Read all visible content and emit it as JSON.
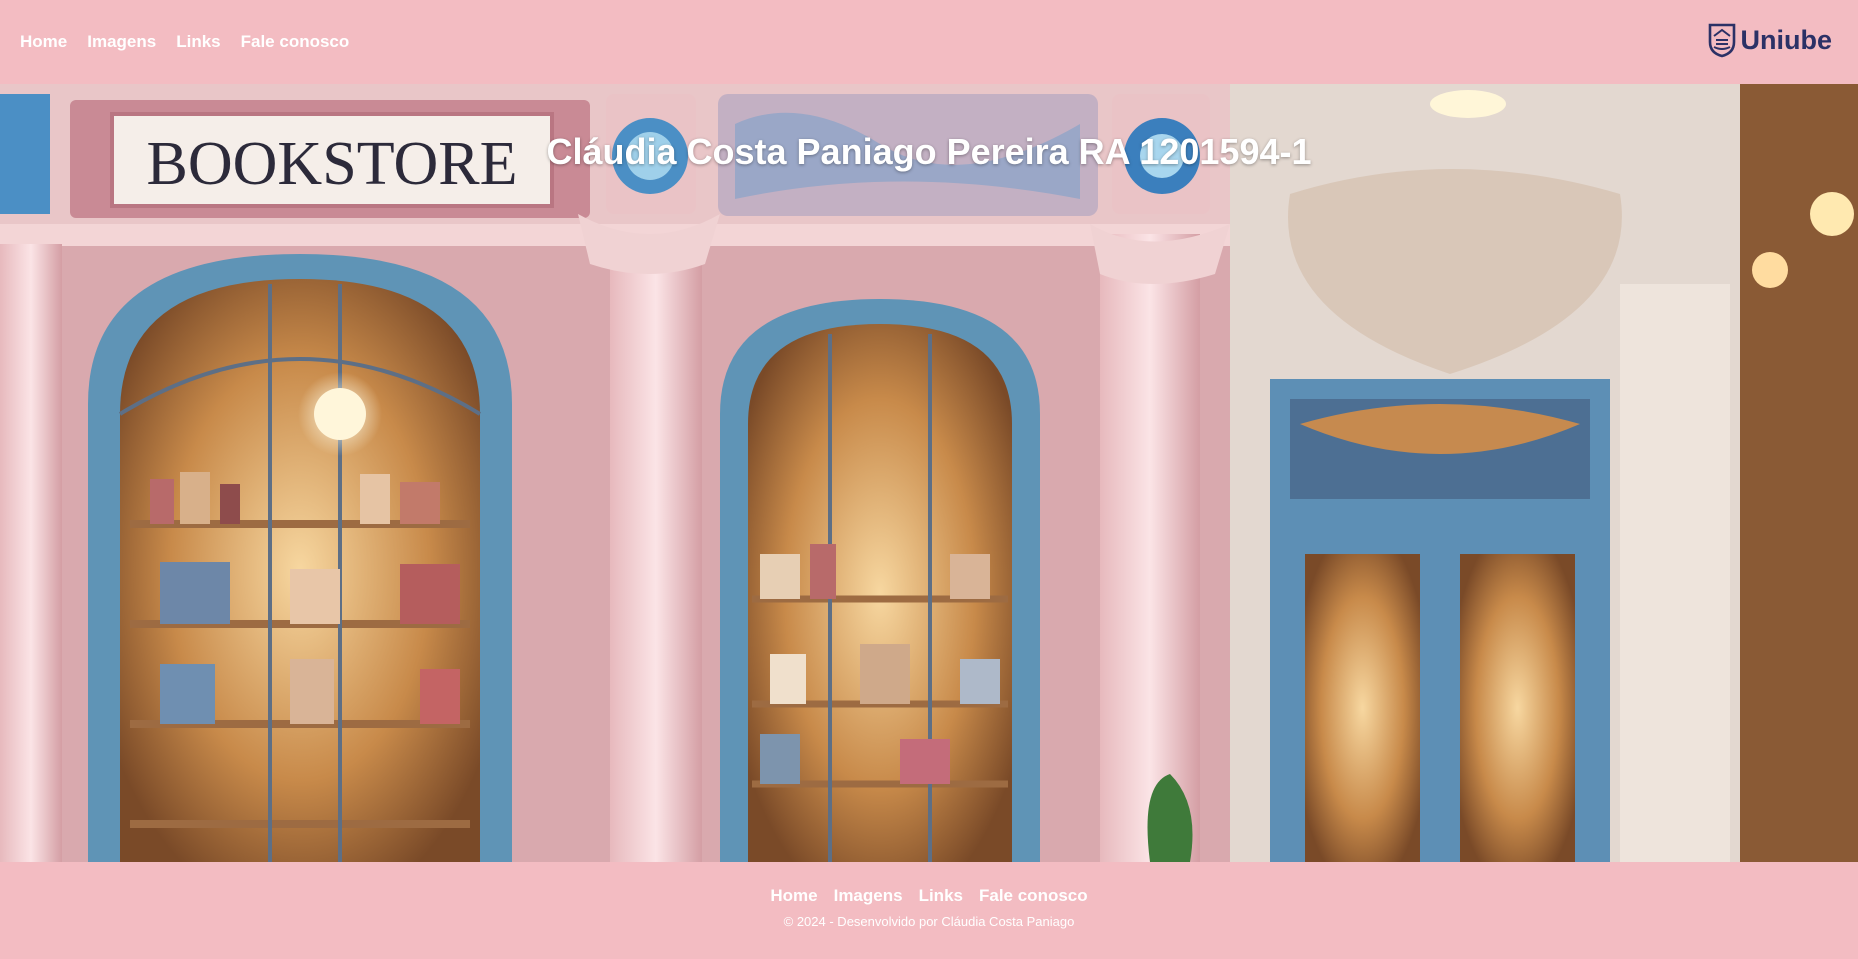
{
  "header": {
    "nav": [
      "Home",
      "Imagens",
      "Links",
      "Fale conosco"
    ],
    "logo_text": "Uniube"
  },
  "hero": {
    "title": "Cláudia Costa Paniago Pereira RA 1201594-1",
    "sign_text": "BOOKSTORE"
  },
  "footer": {
    "nav": [
      "Home",
      "Imagens",
      "Links",
      "Fale conosco"
    ],
    "copyright": "© 2024 - Desenvolvido por Cláudia Costa Paniago"
  },
  "colors": {
    "background": "#f3bcc2",
    "text": "#ffffff",
    "logo": "#2b3166"
  }
}
